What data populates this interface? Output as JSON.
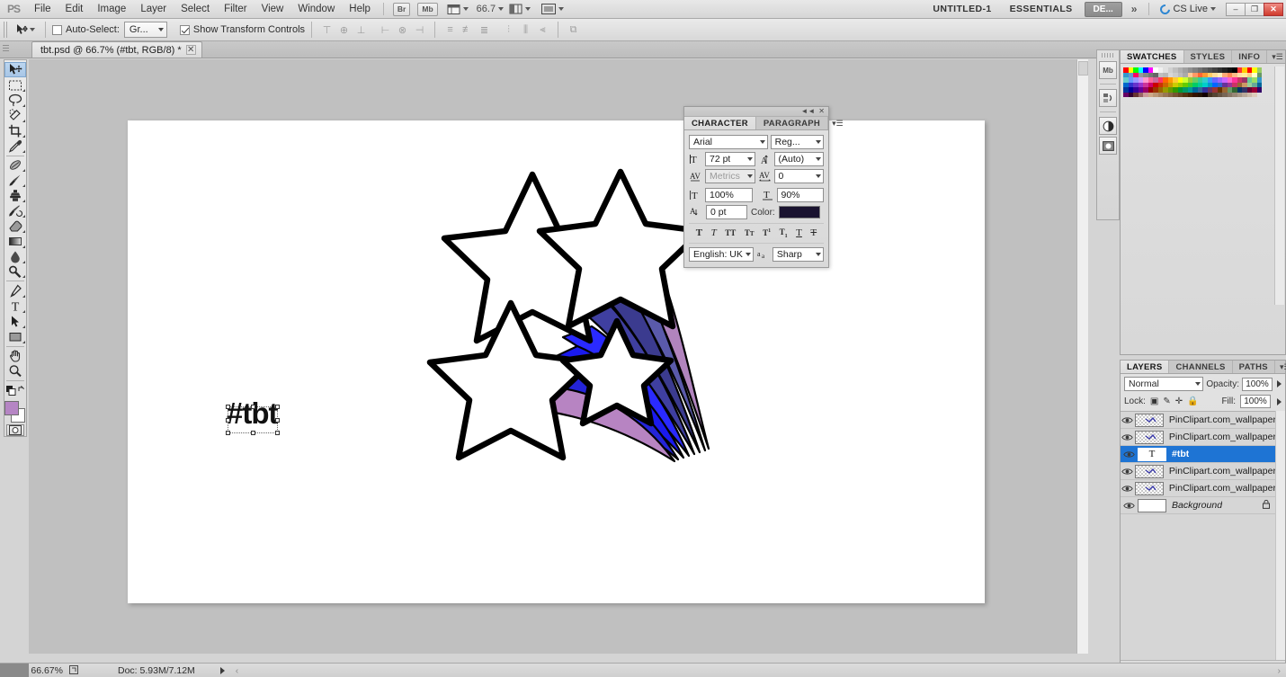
{
  "app": {
    "logo": "PS",
    "menus": [
      "File",
      "Edit",
      "Image",
      "Layer",
      "Select",
      "Filter",
      "View",
      "Window",
      "Help"
    ],
    "bridge_label": "Br",
    "minibridge_label": "Mb",
    "zoom_level": "66.7",
    "document_name": "UNTITLED-1",
    "workspace": "ESSENTIALS",
    "workspace_more": "DE...",
    "chevron": "»",
    "cslive": "CS Live",
    "window_minimize": "–",
    "window_restore": "❐",
    "window_close": "✕"
  },
  "options_bar": {
    "auto_select_label": "Auto-Select:",
    "auto_select_checked": false,
    "auto_select_value": "Gr...",
    "show_transform_label": "Show Transform Controls",
    "show_transform_checked": true,
    "align_icons": [
      "align-top-edges",
      "align-vertical-centers",
      "align-bottom-edges",
      "align-left-edges",
      "align-horizontal-centers",
      "align-right-edges"
    ],
    "distribute_icons": [
      "distribute-top-edges",
      "distribute-vertical-centers",
      "distribute-bottom-edges",
      "distribute-left-edges",
      "distribute-horizontal-centers",
      "distribute-right-edges"
    ],
    "auto_align_icon": "auto-align-layers"
  },
  "document_tab": {
    "title": "tbt.psd @ 66.7% (#tbt, RGB/8) *",
    "close": "✕"
  },
  "toolbar": {
    "tools": [
      {
        "name": "move-tool",
        "active": true
      },
      {
        "name": "rectangular-marquee-tool",
        "active": false
      },
      {
        "name": "lasso-tool",
        "active": false
      },
      {
        "name": "quick-selection-tool",
        "active": false
      },
      {
        "name": "crop-tool",
        "active": false
      },
      {
        "name": "eyedropper-tool",
        "active": false
      },
      {
        "name": "spot-healing-brush-tool",
        "active": false
      },
      {
        "name": "brush-tool",
        "active": false
      },
      {
        "name": "clone-stamp-tool",
        "active": false
      },
      {
        "name": "history-brush-tool",
        "active": false
      },
      {
        "name": "eraser-tool",
        "active": false
      },
      {
        "name": "gradient-tool",
        "active": false
      },
      {
        "name": "blur-tool",
        "active": false
      },
      {
        "name": "dodge-tool",
        "active": false
      },
      {
        "name": "pen-tool",
        "active": false
      },
      {
        "name": "horizontal-type-tool",
        "active": false
      },
      {
        "name": "path-selection-tool",
        "active": false
      },
      {
        "name": "rectangle-tool",
        "active": false
      },
      {
        "name": "hand-tool",
        "active": false
      },
      {
        "name": "zoom-tool",
        "active": false
      }
    ],
    "foreground_color": "#b585c4",
    "background_color": "#ffffff",
    "quick_mask": "quick-mask-mode"
  },
  "canvas": {
    "background_color": "#c0c0c0",
    "document_color": "#ffffff",
    "text_layer_value": "#tbt"
  },
  "character_panel": {
    "tabs": [
      "CHARACTER",
      "PARAGRAPH"
    ],
    "active_tab": "CHARACTER",
    "font_family": "Arial",
    "font_style": "Reg...",
    "font_size": "72 pt",
    "leading": "(Auto)",
    "kerning": "Metrics",
    "tracking": "0",
    "vertical_scale": "100%",
    "horizontal_scale": "90%",
    "baseline_shift": "0 pt",
    "color_label": "Color:",
    "color_value": "#1a1330",
    "style_buttons": [
      "faux-bold",
      "faux-italic",
      "all-caps",
      "small-caps",
      "superscript",
      "subscript",
      "underline",
      "strikethrough"
    ],
    "language": "English: UK",
    "anti_alias": "Sharp"
  },
  "dock_icons": [
    {
      "name": "mini-bridge-icon",
      "label": "Mb"
    },
    {
      "name": "history-icon",
      "label": ""
    },
    {
      "name": "adjustments-icon",
      "label": ""
    },
    {
      "name": "masks-icon",
      "label": ""
    }
  ],
  "swatches_panel": {
    "tabs": [
      "SWATCHES",
      "STYLES",
      "INFO"
    ],
    "active_tab": "SWATCHES",
    "colors": [
      "#ff0000",
      "#ffff00",
      "#00ff00",
      "#00ffff",
      "#0000ff",
      "#ff00ff",
      "#ffffff",
      "#f0f0f0",
      "#e0e0e0",
      "#d0d0d0",
      "#c0c0c0",
      "#b0b0b0",
      "#a0a0a0",
      "#909090",
      "#808080",
      "#707070",
      "#606060",
      "#505050",
      "#404040",
      "#303030",
      "#202020",
      "#101010",
      "#000000",
      "#ff3333",
      "#ffcc00",
      "#ff0000",
      "#ffff00",
      "#99cc66",
      "#3399cc",
      "#6699cc",
      "#ff0066",
      "#999999",
      "#888888",
      "#777777",
      "#666666",
      "#c0c0c0",
      "#b8b8b8",
      "#d8d8d8",
      "#cccccc",
      "#bbbbbb",
      "#aaaaaa",
      "#ffcc99",
      "#ff9966",
      "#ff6633",
      "#ff9933",
      "#ffcc66",
      "#ffdd99",
      "#ffeebb",
      "#ffaa77",
      "#ff8855",
      "#ffbb88",
      "#ffddaa",
      "#ffee99",
      "#ffcc88",
      "#ffffcc",
      "#669966",
      "#66cccc",
      "#6699ff",
      "#9999ff",
      "#cc99ff",
      "#ff99cc",
      "#ff6699",
      "#cc6699",
      "#ff3366",
      "#ff6600",
      "#ff9900",
      "#ffcc33",
      "#ffff00",
      "#ccff33",
      "#99cc33",
      "#66cc66",
      "#33cc99",
      "#33cccc",
      "#3399ff",
      "#6666ff",
      "#9966ff",
      "#cc66ff",
      "#ff66cc",
      "#ff3399",
      "#cc3366",
      "#993366",
      "#66cc99",
      "#99dd66",
      "#3399cc",
      "#0066cc",
      "#3333cc",
      "#6633cc",
      "#9933cc",
      "#cc3399",
      "#cc0066",
      "#cc0000",
      "#cc3300",
      "#cc6600",
      "#cc9900",
      "#cccc00",
      "#99cc00",
      "#66cc00",
      "#33cc33",
      "#00cc66",
      "#00cc99",
      "#00cccc",
      "#0099cc",
      "#0066ff",
      "#3366cc",
      "#663399",
      "#993399",
      "#cc3366",
      "#996633",
      "#cc9966",
      "#99cc99",
      "#66aa99",
      "#006699",
      "#003399",
      "#000099",
      "#330099",
      "#660099",
      "#990066",
      "#990000",
      "#993300",
      "#996600",
      "#999900",
      "#669900",
      "#339900",
      "#009933",
      "#009966",
      "#009999",
      "#006699",
      "#336699",
      "#333399",
      "#663366",
      "#993333",
      "#663300",
      "#996633",
      "#669966",
      "#336633",
      "#003366",
      "#333366",
      "#660033",
      "#990033",
      "#330066",
      "#660066",
      "#330033",
      "#663333",
      "#996666",
      "#cc9999",
      "#ccaa88",
      "#bb9977",
      "#aa8866",
      "#997755",
      "#886644",
      "#775533",
      "#664422",
      "#553311",
      "#442200",
      "#331100",
      "#221100",
      "#110000",
      "#443322",
      "#554433",
      "#665544",
      "#776655",
      "#887766",
      "#998877",
      "#aa9988",
      "#bbaa99",
      "#ccbbaa",
      "#ddccbb"
    ]
  },
  "layers_panel": {
    "tabs": [
      "LAYERS",
      "CHANNELS",
      "PATHS"
    ],
    "active_tab": "LAYERS",
    "blend_mode": "Normal",
    "opacity_label": "Opacity:",
    "opacity_value": "100%",
    "lock_label": "Lock:",
    "fill_label": "Fill:",
    "fill_value": "100%",
    "lock_icons": [
      "lock-transparent-pixels",
      "lock-image-pixels",
      "lock-position",
      "lock-all"
    ],
    "layers": [
      {
        "name": "PinClipart.com_wallpaper-cli...",
        "type": "raster",
        "selected": false,
        "visible": true,
        "locked": false
      },
      {
        "name": "PinClipart.com_wallpaper-cli...",
        "type": "raster",
        "selected": false,
        "visible": true,
        "locked": false
      },
      {
        "name": "#tbt",
        "type": "text",
        "selected": true,
        "visible": true,
        "locked": false
      },
      {
        "name": "PinClipart.com_wallpaper-cli...",
        "type": "raster",
        "selected": false,
        "visible": true,
        "locked": false
      },
      {
        "name": "PinClipart.com_wallpaper-cli...",
        "type": "raster",
        "selected": false,
        "visible": true,
        "locked": false
      },
      {
        "name": "Background",
        "type": "background",
        "selected": false,
        "visible": true,
        "locked": true
      }
    ],
    "footer_icons": [
      "link-layers",
      "add-layer-style",
      "add-layer-mask",
      "new-adjustment-layer",
      "new-group",
      "new-layer",
      "delete-layer"
    ]
  },
  "status_bar": {
    "zoom": "66.67%",
    "doc_info": "Doc: 5.93M/7.12M"
  }
}
